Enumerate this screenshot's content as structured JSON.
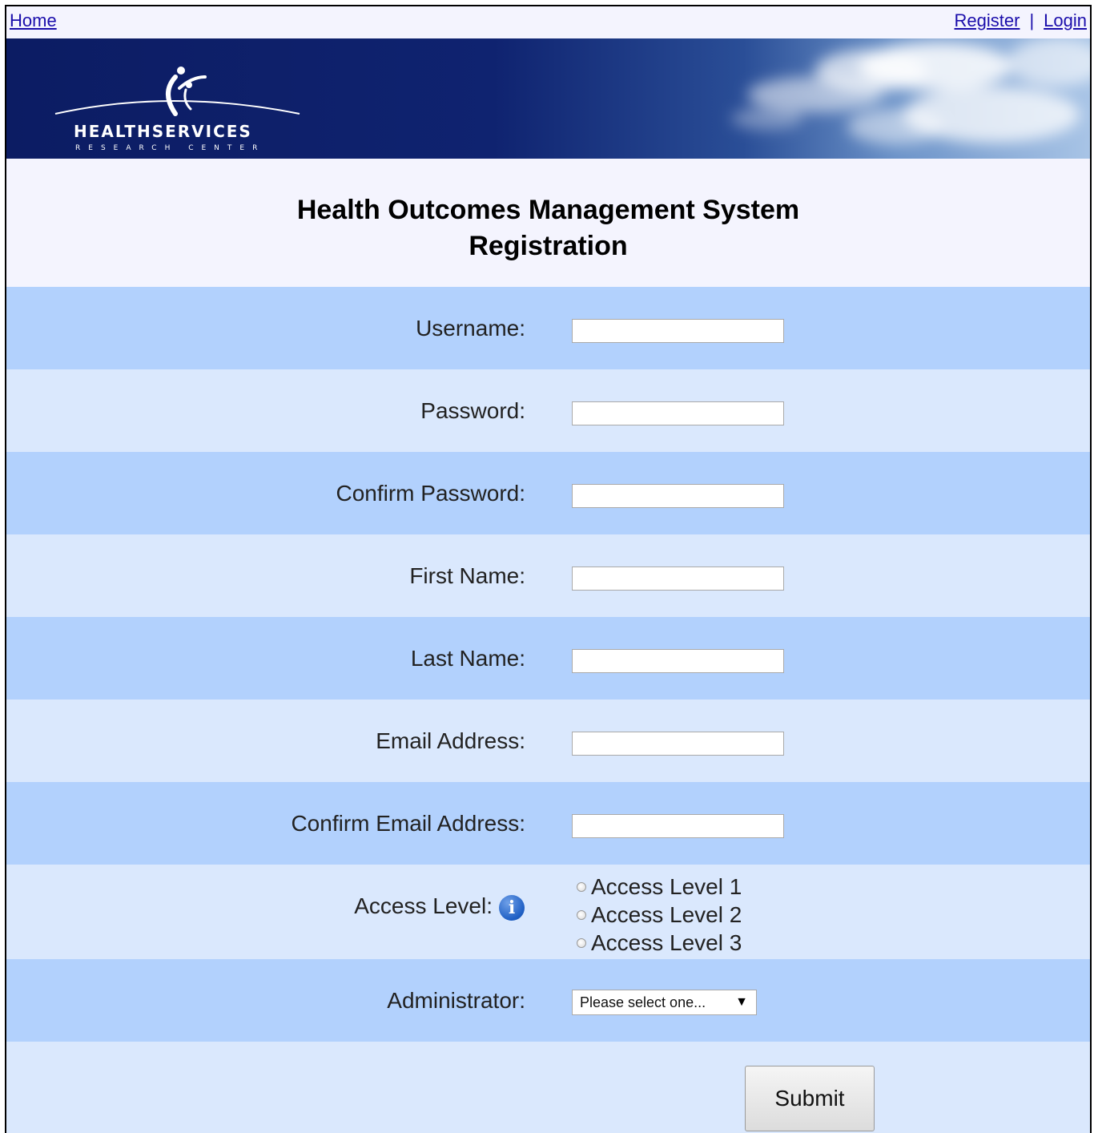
{
  "nav": {
    "home": "Home",
    "register": "Register",
    "separator": "|",
    "login": "Login"
  },
  "banner": {
    "logo_title": "HEALTHSERVICES",
    "logo_subtitle": "RESEARCH CENTER"
  },
  "page": {
    "title_line1": "Health Outcomes Management System",
    "title_line2": "Registration"
  },
  "form": {
    "username_label": "Username:",
    "username_value": "",
    "password_label": "Password:",
    "password_value": "",
    "confirm_password_label": "Confirm Password:",
    "confirm_password_value": "",
    "first_name_label": "First Name:",
    "first_name_value": "",
    "last_name_label": "Last Name:",
    "last_name_value": "",
    "email_label": "Email Address:",
    "email_value": "",
    "confirm_email_label": "Confirm Email Address:",
    "confirm_email_value": "",
    "access_level_label": "Access Level:",
    "access_levels": [
      "Access Level 1",
      "Access Level 2",
      "Access Level 3"
    ],
    "administrator_label": "Administrator:",
    "administrator_selected": "Please select one...",
    "submit_label": "Submit"
  },
  "icons": {
    "info": "info-icon",
    "dropdown_arrow": "chevron-down-icon"
  },
  "colors": {
    "row_dark": "#b2d1fd",
    "row_light": "#dae8fd",
    "banner": "#0f2370",
    "link": "#1a0dab"
  }
}
